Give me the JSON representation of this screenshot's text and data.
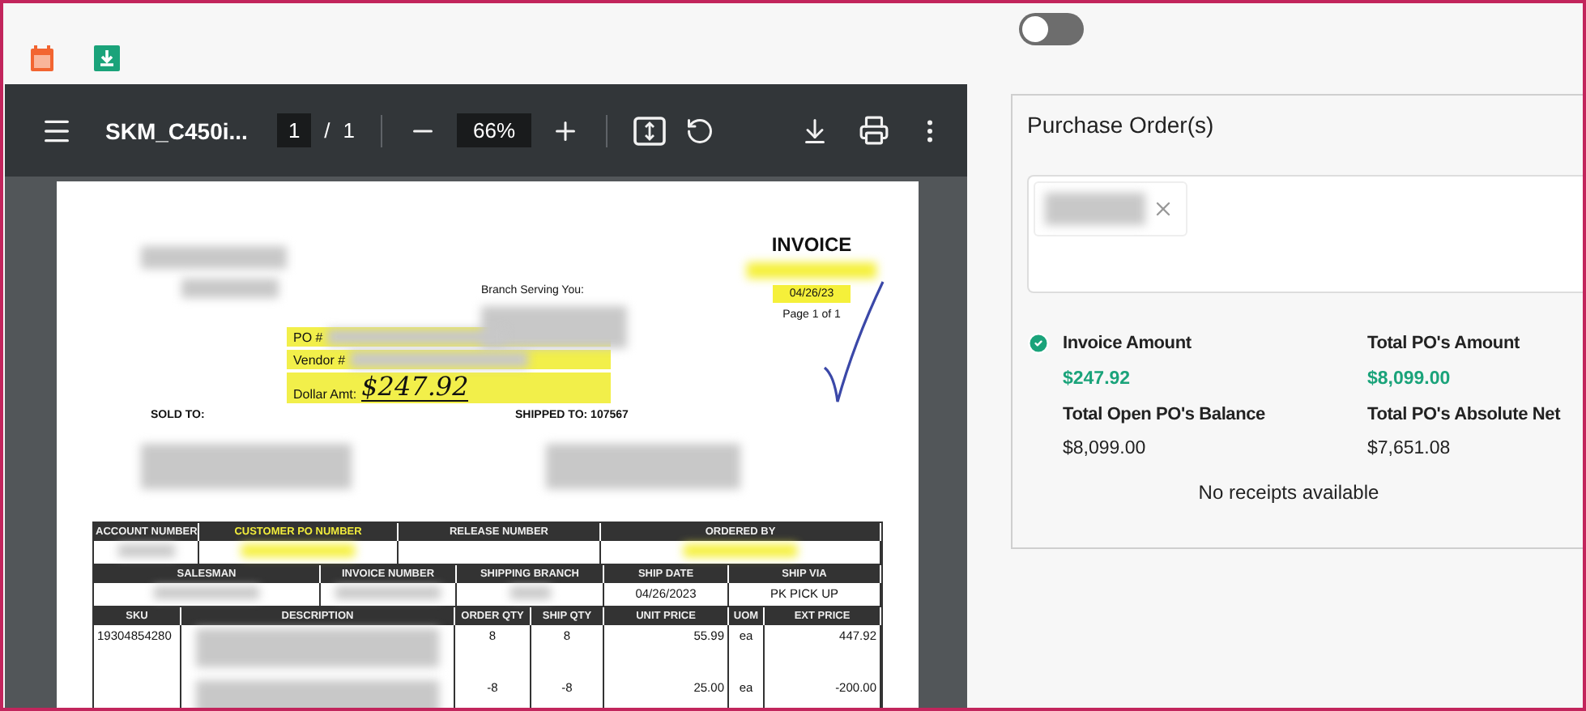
{
  "toggle": {
    "on": false
  },
  "viewer": {
    "file_name": "SKM_C450i...",
    "page_current": "1",
    "page_separator": "/",
    "page_total": "1",
    "zoom": "66%"
  },
  "document": {
    "title": "INVOICE",
    "branch_label": "Branch Serving You:",
    "date": "04/26/23",
    "page": "Page 1 of 1",
    "stamp": [
      {
        "label": "PO #"
      },
      {
        "label": "Vendor #"
      },
      {
        "label": "Dollar Amt:",
        "value": "$247.92"
      }
    ],
    "sold_to": "SOLD TO:",
    "shipped_to": "SHIPPED TO: 107567",
    "order_headers": [
      {
        "text": "ACCOUNT NUMBER",
        "highlighted": false
      },
      {
        "text": "CUSTOMER PO NUMBER",
        "highlighted": true
      },
      {
        "text": "RELEASE NUMBER",
        "highlighted": false
      },
      {
        "text": "ORDERED BY",
        "highlighted": false
      }
    ],
    "order_values": [
      {
        "kind": "redacted"
      },
      {
        "kind": "highlighted"
      },
      {
        "kind": "empty"
      },
      {
        "kind": "highlighted"
      }
    ],
    "ship_headers": [
      "SALESMAN",
      "INVOICE NUMBER",
      "SHIPPING BRANCH",
      "SHIP DATE",
      "SHIP VIA"
    ],
    "ship_values": [
      {
        "kind": "redacted"
      },
      {
        "kind": "redacted"
      },
      {
        "kind": "redacted"
      },
      {
        "kind": "text",
        "text": "04/26/2023"
      },
      {
        "kind": "text",
        "text": "PK PICK UP"
      }
    ],
    "item_columns": [
      "SKU",
      "DESCRIPTION",
      "ORDER QTY",
      "SHIP QTY",
      "UNIT PRICE",
      "UOM",
      "EXT PRICE"
    ],
    "item_rows": [
      {
        "sku": "19304854280",
        "order_qty": "8",
        "ship_qty": "8",
        "unit_price": "55.99",
        "uom": "ea",
        "ext_price": "447.92"
      },
      {
        "order_qty": "-8",
        "ship_qty": "-8",
        "unit_price": "25.00",
        "uom": "ea",
        "ext_price": "-200.00"
      }
    ]
  },
  "purchase_orders": {
    "title": "Purchase Order(s)",
    "chips": [
      {
        "kind": "redacted"
      }
    ],
    "summary": [
      {
        "label": "Invoice Amount",
        "value": "$247.92",
        "verified": true,
        "highlighted": true
      },
      {
        "label": "Total PO's Amount",
        "value": "$8,099.00",
        "verified": false,
        "highlighted": true
      },
      {
        "label": "Total Open PO's Balance",
        "value": "$8,099.00",
        "verified": false,
        "highlighted": false
      },
      {
        "label": "Total PO's Absolute Net",
        "value": "$7,651.08",
        "verified": false,
        "highlighted": false
      }
    ],
    "note": "No receipts available"
  }
}
